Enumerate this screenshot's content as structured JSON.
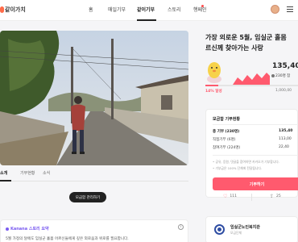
{
  "header": {
    "logo": "같이가치",
    "nav": [
      "홈",
      "매일기부",
      "같이기부",
      "스토리",
      "행페인"
    ],
    "active_nav": "같이기부"
  },
  "campaign": {
    "title_line1": "가장 외로운 5월, 임실군 홀몸",
    "title_line2": "르신께 찾아가는 사랑",
    "amount": "135,40",
    "donors": "230명 참",
    "progress_fraction": 0.14,
    "percent_label": "14% 달성",
    "goal": "1,000,00"
  },
  "tabs": [
    "소개",
    "기부현황",
    "소식"
  ],
  "more_button": "모금함 관리하기",
  "summary": {
    "title": "Kanana 스토리 요약",
    "text": "5월 가정의 달에도 임실군 홀몸 어르신들에게 깊은 외로움과 위로를 필요합니다."
  },
  "status": {
    "title": "모금함 기부현황",
    "rows": [
      {
        "label": "총 기부 (230명)",
        "value": "135,40"
      },
      {
        "label": "직접기부 (6명)",
        "value": "113,00"
      },
      {
        "label": "참여기부 (224명)",
        "value": "22,40"
      }
    ],
    "notes": [
      "• 공유, 응원, 댓글을 참여하면 카카오가 기부합니다.",
      "• 기부금은 100% 단체에 전달됩니다."
    ],
    "donate_button": "기부하기"
  },
  "actions": {
    "likes": "111",
    "shares": "25"
  },
  "org": {
    "name": "임실군노인복지관",
    "sub": "모금단체"
  },
  "colors": {
    "accent": "#ff5a6e",
    "purple": "#7b5cf0"
  }
}
